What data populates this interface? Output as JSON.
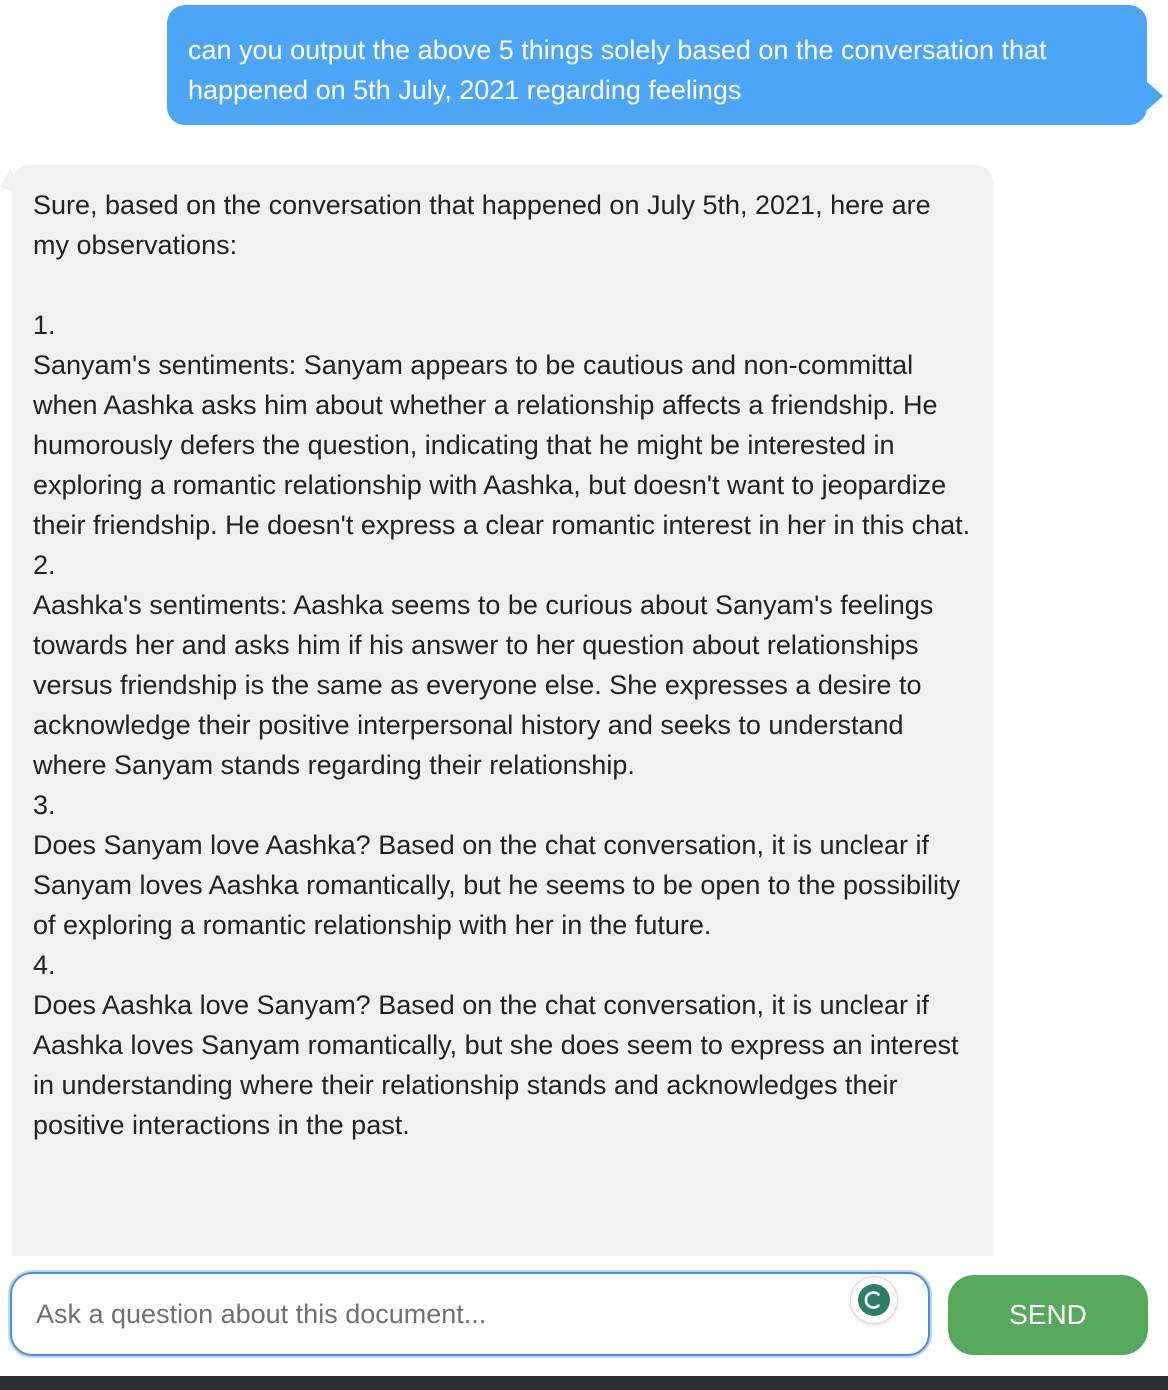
{
  "messages": {
    "user": {
      "text": "can you output the above 5 things solely based on the conversation that happened on 5th July, 2021 regarding feelings"
    },
    "assistant": {
      "intro": "Sure, based on the conversation that happened on July 5th, 2021, here are my observations:",
      "items": [
        {
          "number": "1.",
          "text": "Sanyam's sentiments: Sanyam appears to be cautious and non-committal when Aashka asks him about whether a relationship affects a friendship. He humorously defers the question, indicating that he might be interested in exploring a romantic relationship with Aashka, but doesn't want to jeopardize their friendship. He doesn't express a clear romantic interest in her in this chat."
        },
        {
          "number": "2.",
          "text": "Aashka's sentiments: Aashka seems to be curious about Sanyam's feelings towards her and asks him if his answer to her question about relationships versus friendship is the same as everyone else. She expresses a desire to acknowledge their positive interpersonal history and seeks to understand where Sanyam stands regarding their relationship."
        },
        {
          "number": "3.",
          "text": "Does Sanyam love Aashka? Based on the chat conversation, it is unclear if Sanyam loves Aashka romantically, but he seems to be open to the possibility of exploring a romantic relationship with her in the future."
        },
        {
          "number": "4.",
          "text": "Does Aashka love Sanyam? Based on the chat conversation, it is unclear if Aashka loves Sanyam romantically, but she does seem to express an interest in understanding where their relationship stands and acknowledges their positive interactions in the past."
        }
      ]
    }
  },
  "input": {
    "placeholder": "Ask a question about this document...",
    "value": ""
  },
  "send_button": {
    "label": "SEND"
  },
  "icons": {
    "grammar": "grammar-assistant-icon"
  },
  "colors": {
    "user_bubble": "#4da6f5",
    "assistant_bubble": "#f0f0f0",
    "send_button": "#56a95a",
    "input_focus_border": "#4a90d9"
  }
}
